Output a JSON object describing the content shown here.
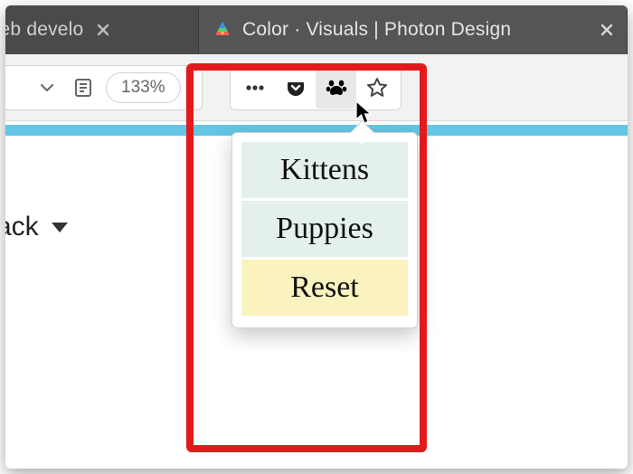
{
  "tabs": {
    "left_partial_label": "e Web develo",
    "active_label": "Color · Visuals | Photon Design"
  },
  "toolbar": {
    "zoom_label": "133%"
  },
  "content": {
    "dropdown_fragment": "ack"
  },
  "popup": {
    "item1": "Kittens",
    "item2": "Puppies",
    "item3": "Reset"
  }
}
